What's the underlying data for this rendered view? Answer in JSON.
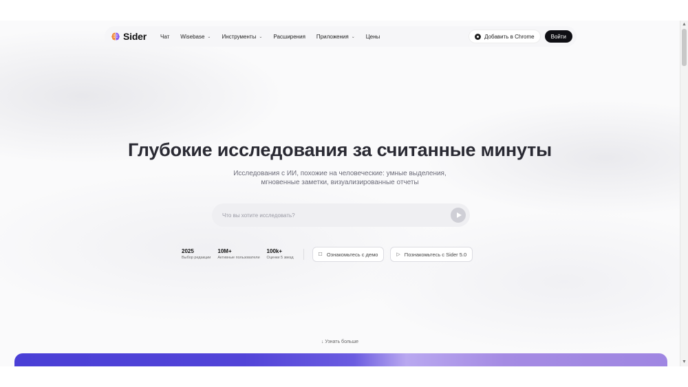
{
  "nav": {
    "brand": "Sider",
    "items": [
      {
        "label": "Чат",
        "has_menu": false
      },
      {
        "label": "Wisebase",
        "has_menu": true
      },
      {
        "label": "Инструменты",
        "has_menu": true
      },
      {
        "label": "Расширения",
        "has_menu": false
      },
      {
        "label": "Приложения",
        "has_menu": true
      },
      {
        "label": "Цены",
        "has_menu": false
      }
    ],
    "chrome_button": "Добавить в Chrome",
    "login_button": "Войти"
  },
  "hero": {
    "title": "Глубокие исследования за считанные минуты",
    "subtitle_line1": "Исследования с ИИ, похожие на человеческие: умные выделения,",
    "subtitle_line2": "мгновенные заметки, визуализированные отчеты"
  },
  "search": {
    "placeholder": "Что вы хотите исследовать?",
    "value": ""
  },
  "stats": [
    {
      "value": "2025",
      "label": "Выбор редакции"
    },
    {
      "value": "10M+",
      "label": "Активные пользователи"
    },
    {
      "value": "100k+",
      "label": "Оценки 5 звезд"
    }
  ],
  "actions": {
    "demo": "Ознакомьтесь с демо",
    "sider5": "Познакомьтесь с Sider 5.0"
  },
  "footer_hint": "Узнать больше",
  "colors": {
    "accent_dark": "#0f0f14",
    "band_start": "#4a3fd6",
    "band_end": "#9f86e2"
  }
}
